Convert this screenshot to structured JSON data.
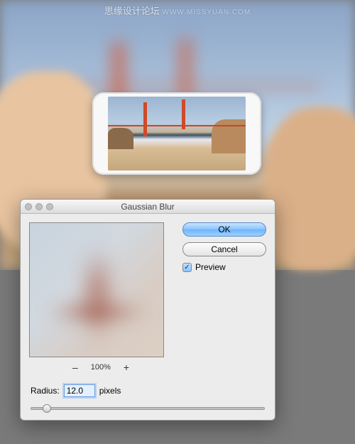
{
  "watermark": {
    "text": "思缘设计论坛",
    "url": "WWW.MISSYUAN.COM"
  },
  "dialog": {
    "title": "Gaussian Blur",
    "ok_label": "OK",
    "cancel_label": "Cancel",
    "preview_label": "Preview",
    "preview_checked": "✓",
    "zoom_out": "–",
    "zoom_level": "100%",
    "zoom_in": "+",
    "radius_label": "Radius:",
    "radius_value": "12.0",
    "radius_unit": "pixels"
  }
}
